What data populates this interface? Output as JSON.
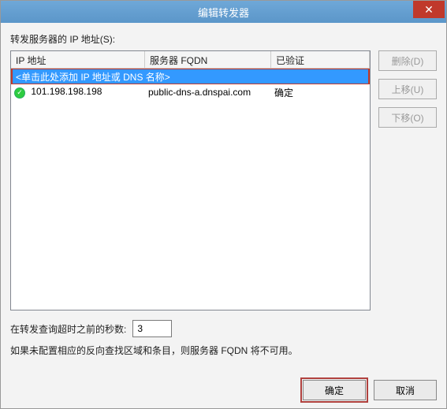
{
  "title": "编辑转发器",
  "close_label": "✕",
  "body": {
    "list_label": "转发服务器的 IP 地址(S):",
    "columns": {
      "ip": "IP 地址",
      "fqdn": "服务器 FQDN",
      "validated": "已验证"
    },
    "input_placeholder": "<单击此处添加 IP 地址或 DNS 名称>",
    "rows": [
      {
        "ip": "101.198.198.198",
        "fqdn": "public-dns-a.dnspai.com",
        "validated": "确定",
        "ok": true
      }
    ],
    "timeout_label": "在转发查询超时之前的秒数:",
    "timeout_value": "3",
    "hint": "如果未配置相应的反向查找区域和条目，则服务器 FQDN 将不可用。"
  },
  "side": {
    "delete": "删除(D)",
    "up": "上移(U)",
    "down": "下移(O)"
  },
  "footer": {
    "ok": "确定",
    "cancel": "取消"
  }
}
